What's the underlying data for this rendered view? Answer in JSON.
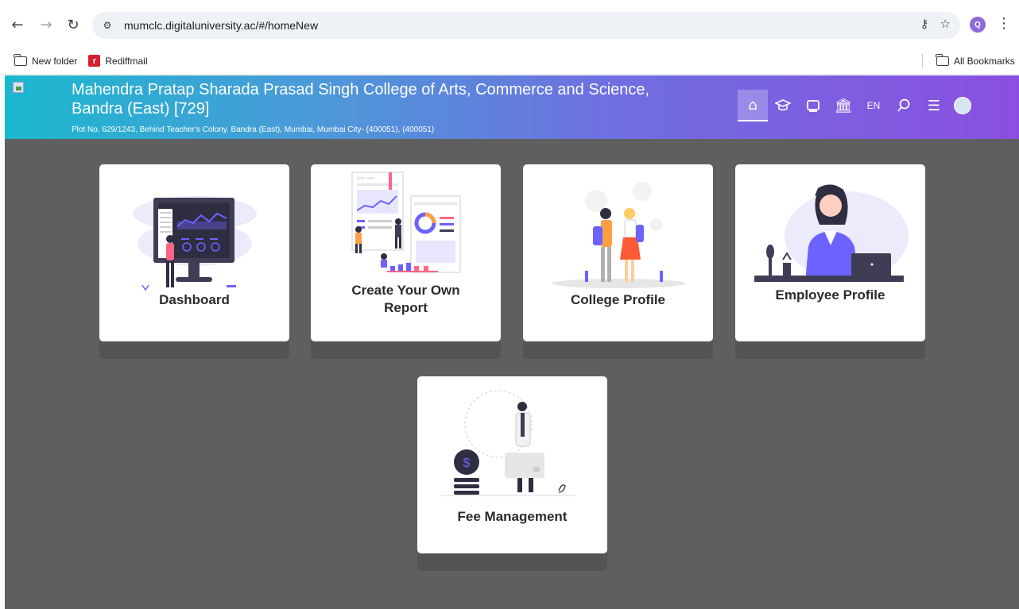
{
  "browser": {
    "url": "mumclc.digitaluniversity.ac/#/homeNew",
    "profile_initial": "Q",
    "bookmarks": [
      {
        "label": "New folder"
      },
      {
        "label": "Rediffmail"
      }
    ],
    "all_bookmarks": "All Bookmarks"
  },
  "header": {
    "college_name": "Mahendra Pratap Sharada Prasad Singh College of Arts, Commerce and Science, Bandra (East) [729]",
    "address": "Plot No. 629/1243, Behind Teacher's Colony. Bandra (East), Mumbai, Mumbai City- (400051), (400051)",
    "language": "EN",
    "icons": [
      "home-icon",
      "graduation-cap-icon",
      "layers-icon",
      "bank-icon",
      "language-toggle",
      "search-icon",
      "menu-icon",
      "avatar"
    ]
  },
  "tiles": [
    {
      "label": "Dashboard"
    },
    {
      "label": "Create Your Own Report"
    },
    {
      "label": "College Profile"
    },
    {
      "label": "Employee Profile"
    },
    {
      "label": "Fee Management"
    }
  ],
  "colors": {
    "header_start": "#1ab8cf",
    "header_end": "#8a4fe0",
    "content_bg": "#5f5f5f",
    "illustration_accent": "#6c63ff"
  }
}
